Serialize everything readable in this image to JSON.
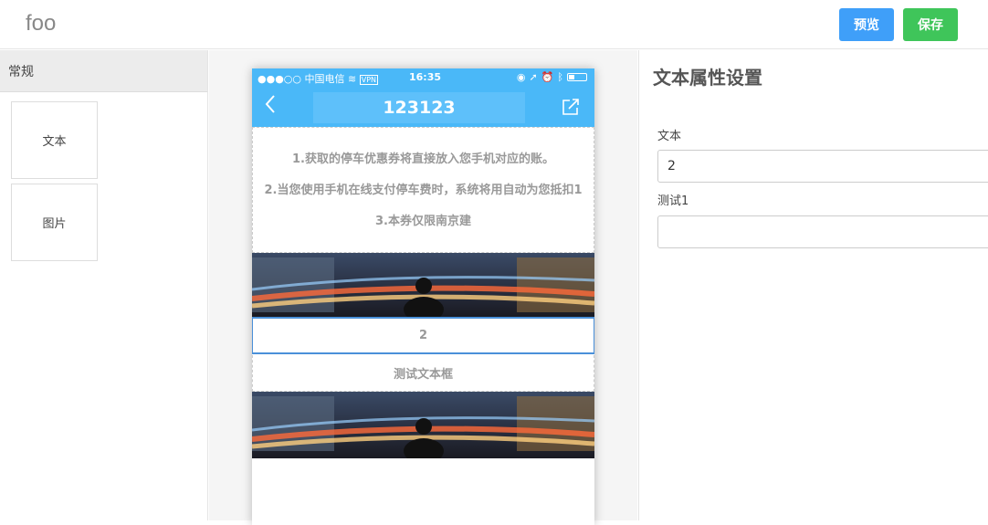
{
  "app": {
    "title": "foo"
  },
  "toolbar": {
    "preview_label": "预览",
    "save_label": "保存",
    "preview_color": "#3f9ff9",
    "save_color": "#3fc55a"
  },
  "sidebar": {
    "section_title": "常规",
    "widgets": [
      {
        "label": "文本"
      },
      {
        "label": "图片"
      }
    ]
  },
  "phone": {
    "statusbar": {
      "carrier": "●●●○○ 中国电信",
      "vpn": "VPN",
      "time": "16:35"
    },
    "nav": {
      "back_icon": "chevron-left-icon",
      "title": "123123",
      "share_icon": "share-icon"
    },
    "text_lines": [
      "1.获取的停车优惠券将直接放入您手机对应的账。",
      "2.当您使用手机在线支付停车费时，系统将用自动为您抵扣1",
      "3.本券仅限南京建"
    ],
    "selected_text": "2",
    "caption": "测试文本框"
  },
  "props": {
    "title": "文本属性设置",
    "fields": [
      {
        "label": "文本",
        "value": "2"
      },
      {
        "label": "测试1",
        "value": ""
      }
    ]
  }
}
